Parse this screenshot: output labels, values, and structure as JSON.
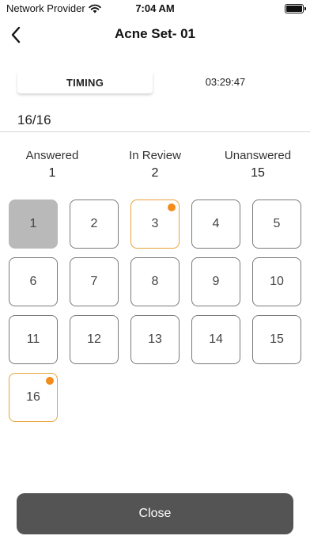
{
  "status_bar": {
    "carrier": "Network Provider",
    "time": "7:04 AM"
  },
  "header": {
    "title": "Acne Set- 01",
    "back_icon": "chevron-left-icon"
  },
  "timing": {
    "tab_label": "TIMING",
    "timer": "03:29:47"
  },
  "progress": "16/16",
  "stats": [
    {
      "label": "Answered",
      "value": "1"
    },
    {
      "label": "In Review",
      "value": "2"
    },
    {
      "label": "Unanswered",
      "value": "15"
    }
  ],
  "questions": [
    {
      "number": "1",
      "state": "answered"
    },
    {
      "number": "2",
      "state": "unanswered"
    },
    {
      "number": "3",
      "state": "review"
    },
    {
      "number": "4",
      "state": "unanswered"
    },
    {
      "number": "5",
      "state": "unanswered"
    },
    {
      "number": "6",
      "state": "unanswered"
    },
    {
      "number": "7",
      "state": "unanswered"
    },
    {
      "number": "8",
      "state": "unanswered"
    },
    {
      "number": "9",
      "state": "unanswered"
    },
    {
      "number": "10",
      "state": "unanswered"
    },
    {
      "number": "11",
      "state": "unanswered"
    },
    {
      "number": "12",
      "state": "unanswered"
    },
    {
      "number": "13",
      "state": "unanswered"
    },
    {
      "number": "14",
      "state": "unanswered"
    },
    {
      "number": "15",
      "state": "unanswered"
    },
    {
      "number": "16",
      "state": "review"
    }
  ],
  "close_label": "Close",
  "colors": {
    "answered": "#b9b9b9",
    "review_border": "#e8a33a",
    "review_dot": "#f28c1b",
    "close_button": "#545454"
  }
}
